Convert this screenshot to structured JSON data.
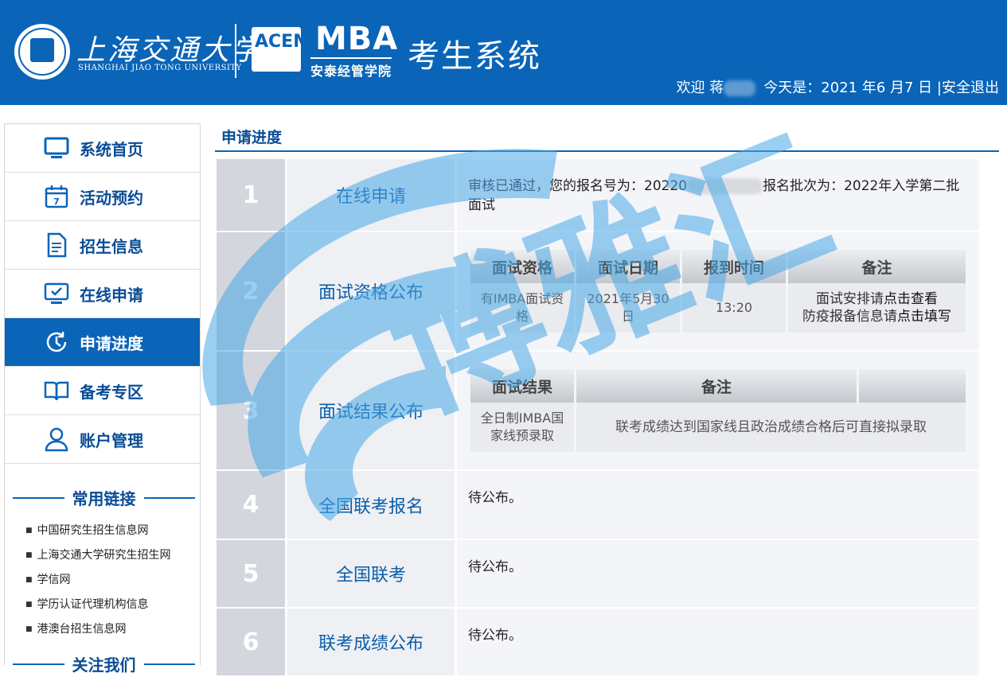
{
  "header": {
    "sjtu_name": "上海交通大学",
    "sjtu_en": "SHANGHAI JIAO TONG UNIVERSITY",
    "acem_letters": "ACEM",
    "mba": "MBA",
    "school": "安泰经管学院",
    "system_title": "考生系统",
    "welcome_prefix": "欢迎 蒋",
    "today": "今天是：2021 年6 月7 日",
    "separator": "|",
    "logout": "安全退出"
  },
  "sidebar": {
    "items": [
      {
        "label": "系统首页",
        "icon": "monitor-icon"
      },
      {
        "label": "活动预约",
        "icon": "calendar-icon"
      },
      {
        "label": "招生信息",
        "icon": "document-icon"
      },
      {
        "label": "在线申请",
        "icon": "screen-check-icon"
      },
      {
        "label": "申请进度",
        "icon": "clock-progress-icon"
      },
      {
        "label": "备考专区",
        "icon": "book-icon"
      },
      {
        "label": "账户管理",
        "icon": "user-icon"
      }
    ],
    "active_index": 4,
    "links_title": "常用链接",
    "links": [
      "中国研究生招生信息网",
      "上海交通大学研究生招生网",
      "学信网",
      "学历认证代理机构信息",
      "港澳台招生信息网"
    ],
    "follow_title": "关注我们"
  },
  "main": {
    "title": "申请进度",
    "steps": [
      {
        "num": "1",
        "name": "在线申请",
        "text_a": "审核已通过，您的报名号为：20220",
        "text_b": "报名批次为：2022年入学第二批面试"
      },
      {
        "num": "2",
        "name": "面试资格公布",
        "headers": [
          "面试资格",
          "面试日期",
          "报到时间",
          "备注"
        ],
        "cells": [
          "有IMBA面试资格",
          "2021年5月30日",
          "13:20",
          "面试安排请",
          "点击查看",
          "防疫报备信息请",
          "点击填写"
        ]
      },
      {
        "num": "3",
        "name": "面试结果公布",
        "headers": [
          "面试结果",
          "备注"
        ],
        "cells": [
          "全日制IMBA国家线预录取",
          "联考成绩达到国家线且政治成绩合格后可直接拟录取"
        ]
      },
      {
        "num": "4",
        "name": "全国联考报名",
        "text": "待公布。"
      },
      {
        "num": "5",
        "name": "全国联考",
        "text": "待公布。"
      },
      {
        "num": "6",
        "name": "联考成绩公布",
        "text": "待公布。"
      }
    ]
  },
  "watermark": {
    "text": "博雅汇"
  },
  "colors": {
    "brand_blue": "#0a64b8",
    "nav_text": "#0a4c96",
    "step_num_bg": "#d3d6dc",
    "watermark": "#4aa8e8"
  }
}
